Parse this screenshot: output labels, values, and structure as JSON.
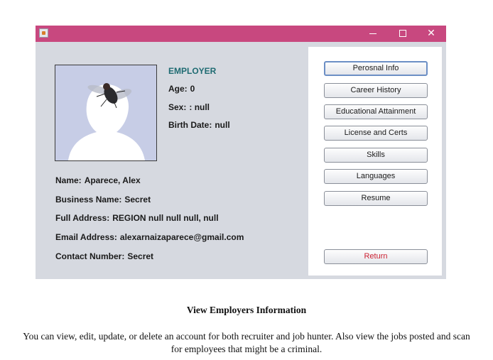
{
  "window": {
    "title_bar_color": "#c8487f",
    "controls": {
      "minimize": "minimize-icon",
      "maximize": "maximize-icon",
      "close": "close-icon"
    }
  },
  "profile": {
    "header": "EMPLOYER",
    "age_label": "Age:",
    "age_value": "0",
    "sex_label": "Sex:",
    "sex_value": ": null",
    "birth_label": "Birth Date:",
    "birth_value": "null",
    "name_label": "Name:",
    "name_value": "Aparece, Alex",
    "business_label": "Business Name:",
    "business_value": "Secret",
    "address_label": "Full Address:",
    "address_value": "REGION null null null, null",
    "email_label": "Email Address:",
    "email_value": "alexarnaizaparece@gmail.com",
    "contact_label": "Contact Number:",
    "contact_value": "Secret"
  },
  "nav": {
    "personal": "Perosnal Info",
    "career": "Career History",
    "education": "Educational Attainment",
    "license": "License and Certs",
    "skills": "Skills",
    "languages": "Languages",
    "resume": "Resume",
    "return": "Return"
  },
  "caption": {
    "title": "View Employers Information",
    "body": "You can view, edit, update, or delete an account for both recruiter and job hunter. Also view the jobs posted and scan for employees that might be a criminal."
  }
}
